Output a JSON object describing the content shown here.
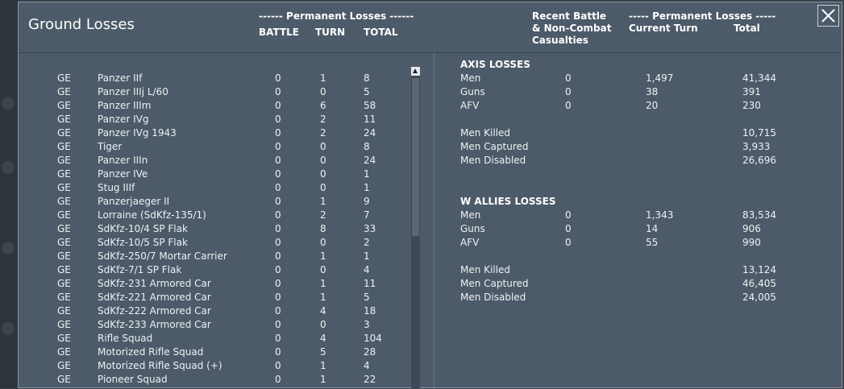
{
  "window": {
    "title": "Ground Losses"
  },
  "header": {
    "perm_losses_left": "------ Permanent Losses ------",
    "col_battle": "BATTLE",
    "col_turn": "TURN",
    "col_total": "TOTAL",
    "recent_battle": "Recent Battle",
    "non_combat": "& Non-Combat",
    "casualties": "Casualties",
    "perm_losses_right": "----- Permanent Losses -----",
    "current_turn": "Current Turn",
    "total": "Total"
  },
  "units": [
    {
      "side": "GE",
      "name": "Panzer IIf",
      "battle": "0",
      "turn": "1",
      "total": "8"
    },
    {
      "side": "GE",
      "name": "Panzer IIIj L/60",
      "battle": "0",
      "turn": "0",
      "total": "5"
    },
    {
      "side": "GE",
      "name": "Panzer IIIm",
      "battle": "0",
      "turn": "6",
      "total": "58"
    },
    {
      "side": "GE",
      "name": "Panzer IVg",
      "battle": "0",
      "turn": "2",
      "total": "11"
    },
    {
      "side": "GE",
      "name": "Panzer IVg 1943",
      "battle": "0",
      "turn": "2",
      "total": "24"
    },
    {
      "side": "GE",
      "name": "Tiger",
      "battle": "0",
      "turn": "0",
      "total": "8"
    },
    {
      "side": "GE",
      "name": "Panzer IIIn",
      "battle": "0",
      "turn": "0",
      "total": "24"
    },
    {
      "side": "GE",
      "name": "Panzer IVe",
      "battle": "0",
      "turn": "0",
      "total": "1"
    },
    {
      "side": "GE",
      "name": "Stug IIIf",
      "battle": "0",
      "turn": "0",
      "total": "1"
    },
    {
      "side": "GE",
      "name": "Panzerjaeger II",
      "battle": "0",
      "turn": "1",
      "total": "9"
    },
    {
      "side": "GE",
      "name": "Lorraine (SdKfz-135/1)",
      "battle": "0",
      "turn": "2",
      "total": "7"
    },
    {
      "side": "GE",
      "name": "SdKfz-10/4 SP Flak",
      "battle": "0",
      "turn": "8",
      "total": "33"
    },
    {
      "side": "GE",
      "name": "SdKfz-10/5 SP Flak",
      "battle": "0",
      "turn": "0",
      "total": "2"
    },
    {
      "side": "GE",
      "name": "SdKfz-250/7 Mortar Carrier",
      "battle": "0",
      "turn": "1",
      "total": "1"
    },
    {
      "side": "GE",
      "name": "SdKfz-7/1 SP Flak",
      "battle": "0",
      "turn": "0",
      "total": "4"
    },
    {
      "side": "GE",
      "name": "SdKfz-231 Armored Car",
      "battle": "0",
      "turn": "1",
      "total": "11"
    },
    {
      "side": "GE",
      "name": "SdKfz-221 Armored Car",
      "battle": "0",
      "turn": "1",
      "total": "5"
    },
    {
      "side": "GE",
      "name": "SdKfz-222 Armored Car",
      "battle": "0",
      "turn": "4",
      "total": "18"
    },
    {
      "side": "GE",
      "name": "SdKfz-233 Armored Car",
      "battle": "0",
      "turn": "0",
      "total": "3"
    },
    {
      "side": "GE",
      "name": "Rifle Squad",
      "battle": "0",
      "turn": "4",
      "total": "104"
    },
    {
      "side": "GE",
      "name": "Motorized Rifle Squad",
      "battle": "0",
      "turn": "5",
      "total": "28"
    },
    {
      "side": "GE",
      "name": "Motorized Rifle Squad (+)",
      "battle": "0",
      "turn": "1",
      "total": "4"
    },
    {
      "side": "GE",
      "name": "Pioneer Squad",
      "battle": "0",
      "turn": "1",
      "total": "22"
    }
  ],
  "axis": {
    "title": "AXIS LOSSES",
    "rows": [
      {
        "label": "Men",
        "recent": "0",
        "current": "1,497",
        "total": "41,344"
      },
      {
        "label": "Guns",
        "recent": "0",
        "current": "38",
        "total": "391"
      },
      {
        "label": "AFV",
        "recent": "0",
        "current": "20",
        "total": "230"
      }
    ],
    "casualties": [
      {
        "label": "Men Killed",
        "total": "10,715"
      },
      {
        "label": "Men Captured",
        "total": "3,933"
      },
      {
        "label": "Men Disabled",
        "total": "26,696"
      }
    ]
  },
  "allies": {
    "title": "W ALLIES LOSSES",
    "rows": [
      {
        "label": "Men",
        "recent": "0",
        "current": "1,343",
        "total": "83,534"
      },
      {
        "label": "Guns",
        "recent": "0",
        "current": "14",
        "total": "906"
      },
      {
        "label": "AFV",
        "recent": "0",
        "current": "55",
        "total": "990"
      }
    ],
    "casualties": [
      {
        "label": "Men Killed",
        "total": "13,124"
      },
      {
        "label": "Men Captured",
        "total": "46,405"
      },
      {
        "label": "Men Disabled",
        "total": "24,005"
      }
    ]
  },
  "icons": {
    "close": "close-icon",
    "scroll_up": "scroll-up-arrow-icon"
  }
}
